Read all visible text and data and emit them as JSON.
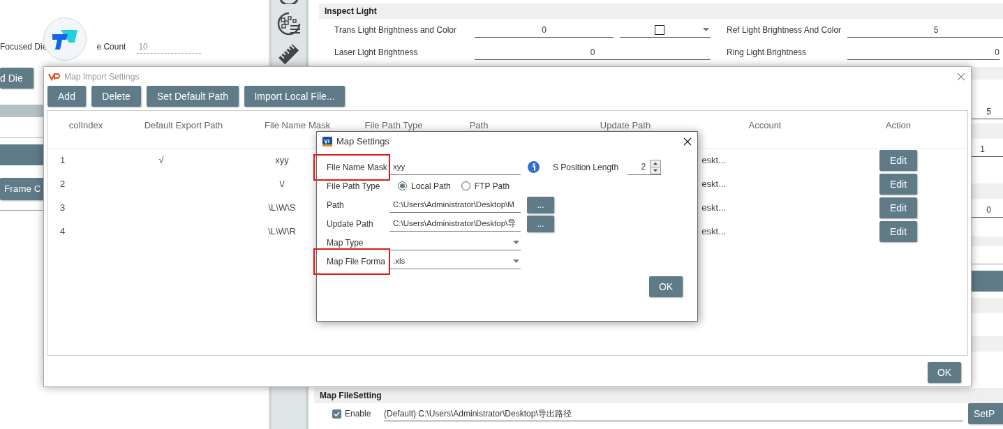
{
  "background": {
    "left_panel": {
      "focused_die_label": "Focused Die",
      "count_label": "e Count",
      "count_value": "10",
      "buttons": [
        {
          "label": "d Die"
        },
        {
          "label": "Frame C"
        }
      ]
    },
    "inspect_light": {
      "title": "Inspect Light",
      "rows": [
        {
          "left_label": "Trans Light Brightness and Color",
          "left_value": "0",
          "color_checked": false,
          "right_label": "Ref Light Brightness And Color",
          "right_value": "5"
        },
        {
          "left_label": "Laser Light Brightness",
          "left_value": "0",
          "right_label": "Ring Light Brightness",
          "right_value": "0"
        }
      ]
    },
    "right_edge_values": [
      "5",
      "1",
      "0"
    ],
    "map_file_setting": {
      "title": "Map FileSetting",
      "enable_label": "Enable",
      "enabled": true,
      "path": "(Default) C:\\Users\\Administrator\\Desktop\\导出路径",
      "button": "SetP"
    }
  },
  "import_dialog": {
    "title": "Map Import Settings",
    "toolbar": [
      "Add",
      "Delete",
      "Set Default Path",
      "Import Local File..."
    ],
    "columns": [
      "colIndex",
      "Default Export Path",
      "File Name Mask",
      "File Path Type",
      "Path",
      "Update Path",
      "Account",
      "Action"
    ],
    "rows": [
      {
        "col_index": "1",
        "default_export": "√",
        "file_name_mask": "xyy",
        "update_path": "eskt...",
        "action": "Edit"
      },
      {
        "col_index": "2",
        "file_name_mask": "\\/",
        "update_path": "eskt...",
        "action": "Edit"
      },
      {
        "col_index": "3",
        "file_name_mask": "\\L\\W\\S",
        "update_path": "eskt...",
        "action": "Edit"
      },
      {
        "col_index": "4",
        "file_name_mask": "\\L\\W\\R",
        "update_path": "eskt...",
        "action": "Edit"
      }
    ],
    "ok": "OK"
  },
  "settings_dialog": {
    "title": "Map Settings",
    "fields": [
      {
        "kind": "text",
        "label": "File Name Mask",
        "value": "xyy",
        "highlighted": true
      },
      {
        "kind": "radio",
        "label": "File Path Type",
        "options": [
          {
            "label": "Local Path",
            "selected": true
          },
          {
            "label": "FTP Path",
            "selected": false
          }
        ],
        "highlighted": false
      },
      {
        "kind": "path",
        "label": "Path",
        "value": "C:\\Users\\Administrator\\Desktop\\M",
        "button": "...",
        "highlighted": false
      },
      {
        "kind": "path",
        "label": "Update Path",
        "value": "C:\\Users\\Administrator\\Desktop\\导",
        "button": "...",
        "highlighted": false
      },
      {
        "kind": "select",
        "label": "Map Type",
        "highlighted": false
      },
      {
        "kind": "select",
        "label": "Map File Forma",
        "value": ".xls",
        "highlighted": true
      }
    ],
    "s_position": {
      "label": "S Position Length",
      "value": "2"
    },
    "ok": "OK"
  }
}
